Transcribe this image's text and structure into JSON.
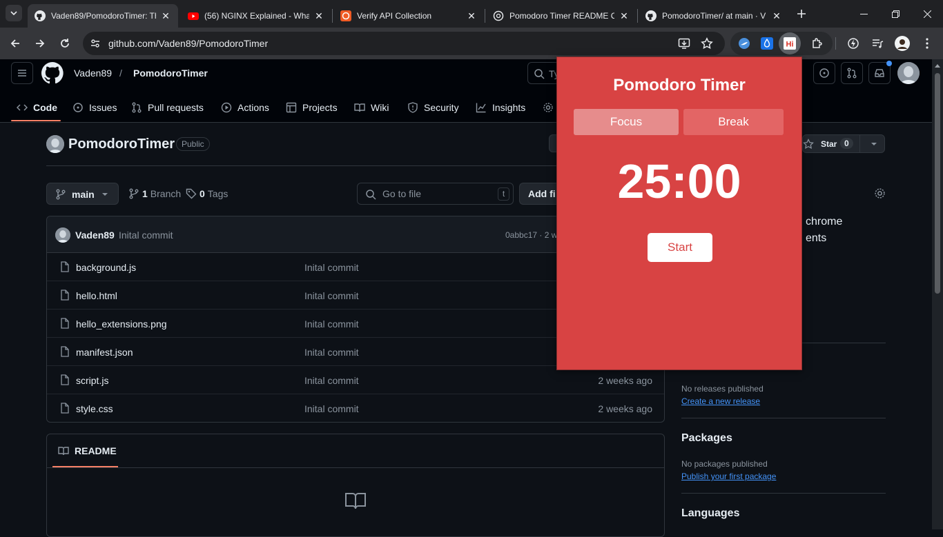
{
  "browser": {
    "tabs": [
      {
        "title": "Vaden89/PomodoroTimer: Th",
        "icon": "github-icon"
      },
      {
        "title": "(56) NGINX Explained - Wha",
        "icon": "youtube-icon"
      },
      {
        "title": "Verify API Collection",
        "icon": "postman-icon"
      },
      {
        "title": "Pomodoro Timer README C",
        "icon": "openai-icon"
      },
      {
        "title": "PomodoroTimer/ at main · V",
        "icon": "github-icon"
      }
    ],
    "url": "github.com/Vaden89/PomodoroTimer"
  },
  "github": {
    "owner": "Vaden89",
    "separator": "/",
    "repo": "PomodoroTimer",
    "search_placeholder": "Ty",
    "nav": {
      "code": "Code",
      "issues": "Issues",
      "pulls": "Pull requests",
      "actions": "Actions",
      "projects": "Projects",
      "wiki": "Wiki",
      "security": "Security",
      "insights": "Insights"
    },
    "repo_title": "PomodoroTimer",
    "visibility": "Public",
    "star_label": "Star",
    "star_count": "0",
    "branch": "main",
    "branch_count": "1",
    "branch_label": "Branch",
    "tag_count": "0",
    "tag_label": "Tags",
    "goto_placeholder": "Go to file",
    "goto_key": "t",
    "add_file": "Add fi",
    "commit": {
      "author": "Vaden89",
      "message": "Inital commit",
      "meta": "0abbc17 · 2 w"
    },
    "files": [
      {
        "name": "background.js",
        "message": "Inital commit",
        "age": ""
      },
      {
        "name": "hello.html",
        "message": "Inital commit",
        "age": ""
      },
      {
        "name": "hello_extensions.png",
        "message": "Inital commit",
        "age": ""
      },
      {
        "name": "manifest.json",
        "message": "Inital commit",
        "age": ""
      },
      {
        "name": "script.js",
        "message": "Inital commit",
        "age": "2 weeks ago"
      },
      {
        "name": "style.css",
        "message": "Inital commit",
        "age": "2 weeks ago"
      }
    ],
    "readme_label": "README",
    "about_line1": "chrome",
    "about_line2": "ents",
    "releases_none": "No releases published",
    "releases_link": "Create a new release",
    "packages_title": "Packages",
    "packages_none": "No packages published",
    "packages_link": "Publish your first package",
    "languages_title": "Languages"
  },
  "popup": {
    "title": "Pomodoro Timer",
    "focus_label": "Focus",
    "break_label": "Break",
    "time": "25:00",
    "start_label": "Start",
    "colors": {
      "background": "#d84343",
      "focus_active": "#e68c8c",
      "break": "#e36565"
    }
  }
}
